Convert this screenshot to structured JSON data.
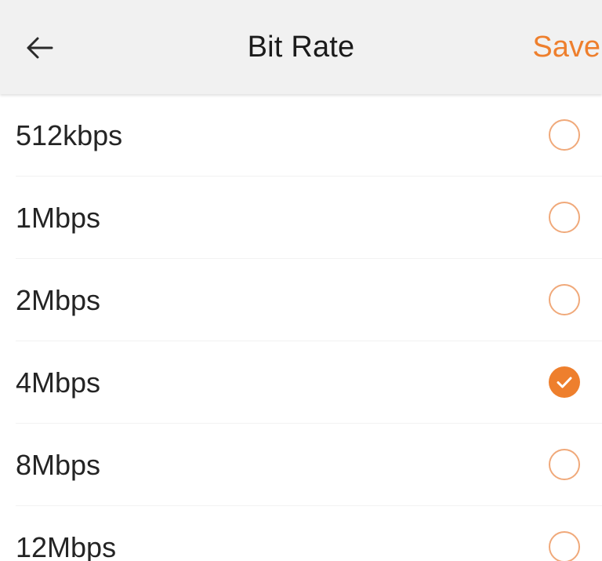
{
  "header": {
    "title": "Bit Rate",
    "save_label": "Save",
    "back_icon": "arrow-left-icon"
  },
  "options": [
    {
      "label": "512kbps",
      "selected": false
    },
    {
      "label": "1Mbps",
      "selected": false
    },
    {
      "label": "2Mbps",
      "selected": false
    },
    {
      "label": "4Mbps",
      "selected": true
    },
    {
      "label": "8Mbps",
      "selected": false
    },
    {
      "label": "12Mbps",
      "selected": false
    }
  ],
  "colors": {
    "accent": "#ee7f2d",
    "header_bg": "#f1f1f1",
    "text": "#242424"
  }
}
